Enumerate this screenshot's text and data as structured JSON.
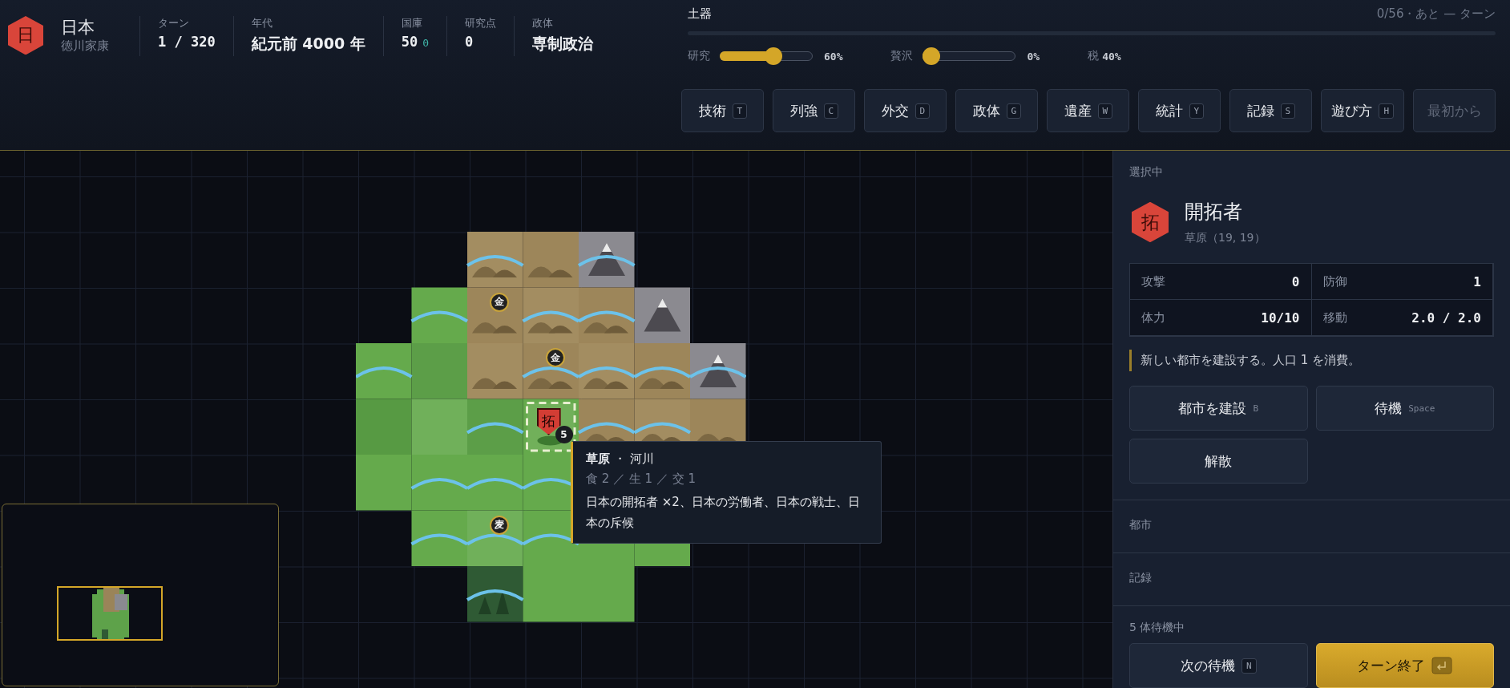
{
  "nation": {
    "emblem": "日",
    "name": "日本",
    "leader": "徳川家康"
  },
  "stats": [
    {
      "label": "ターン",
      "value": "1 / 320",
      "kind": "mono"
    },
    {
      "label": "年代",
      "value": "紀元前 4000 年",
      "kind": "text"
    },
    {
      "label": "国庫",
      "value": "50",
      "delta": "0",
      "kind": "mono"
    },
    {
      "label": "研究点",
      "value": "0",
      "kind": "mono"
    },
    {
      "label": "政体",
      "value": "専制政治",
      "kind": "text"
    }
  ],
  "research": {
    "name": "土器",
    "progress": "0/56・あと — ターン",
    "level": 0
  },
  "sliders": [
    {
      "label": "研究",
      "level": 0.6,
      "reading": "60%"
    },
    {
      "label": "贅沢",
      "level": 0,
      "reading": "0%"
    }
  ],
  "tax": {
    "label": "税",
    "reading": "40%"
  },
  "menu": [
    {
      "label": "技術",
      "key": "T",
      "disabled": false
    },
    {
      "label": "列強",
      "key": "C",
      "disabled": false
    },
    {
      "label": "外交",
      "key": "D",
      "disabled": false
    },
    {
      "label": "政体",
      "key": "G",
      "disabled": false
    },
    {
      "label": "遺産",
      "key": "W",
      "disabled": false
    },
    {
      "label": "統計",
      "key": "Y",
      "disabled": false
    },
    {
      "label": "記録",
      "key": "S",
      "disabled": false
    },
    {
      "label": "遊び方",
      "key": "H",
      "disabled": false
    },
    {
      "label": "最初から",
      "disabled": true
    }
  ],
  "map": {
    "resources": [
      {
        "label": "金"
      },
      {
        "label": "金"
      },
      {
        "label": "麦"
      }
    ],
    "unit": {
      "label": "拓",
      "count": "5",
      "selected": true
    },
    "tooltip": {
      "title": "**草原** ・ 河川",
      "yields": "食 2 ／ 生 1 ／ 交 1",
      "units": "日本の開拓者 ×2、日本の労働者、日本の戦士、日本の斥候"
    }
  },
  "panel": {
    "heading": "選択中",
    "unit": {
      "emblem": "拓",
      "name": "開拓者",
      "location": "草原（19, 19）"
    },
    "stats": [
      {
        "label": "攻撃",
        "value": "0"
      },
      {
        "label": "防御",
        "value": "1"
      },
      {
        "label": "体力",
        "value": "10/10"
      },
      {
        "label": "移動",
        "value": "2.0 / 2.0"
      }
    ],
    "description": "新しい都市を建設する。人口 1 を消費。",
    "actions": [
      {
        "label": "都市を建設",
        "key": "B"
      },
      {
        "label": "待機",
        "key": "Space"
      },
      {
        "label": "解散"
      }
    ],
    "sections": [
      {
        "title": "都市"
      },
      {
        "title": "記録"
      }
    ],
    "idle": "5 体待機中",
    "footer_buttons": [
      {
        "label": "次の待機",
        "key": "N",
        "kind": "secondary"
      },
      {
        "label": "ターン終了",
        "kind": "primary"
      }
    ]
  }
}
